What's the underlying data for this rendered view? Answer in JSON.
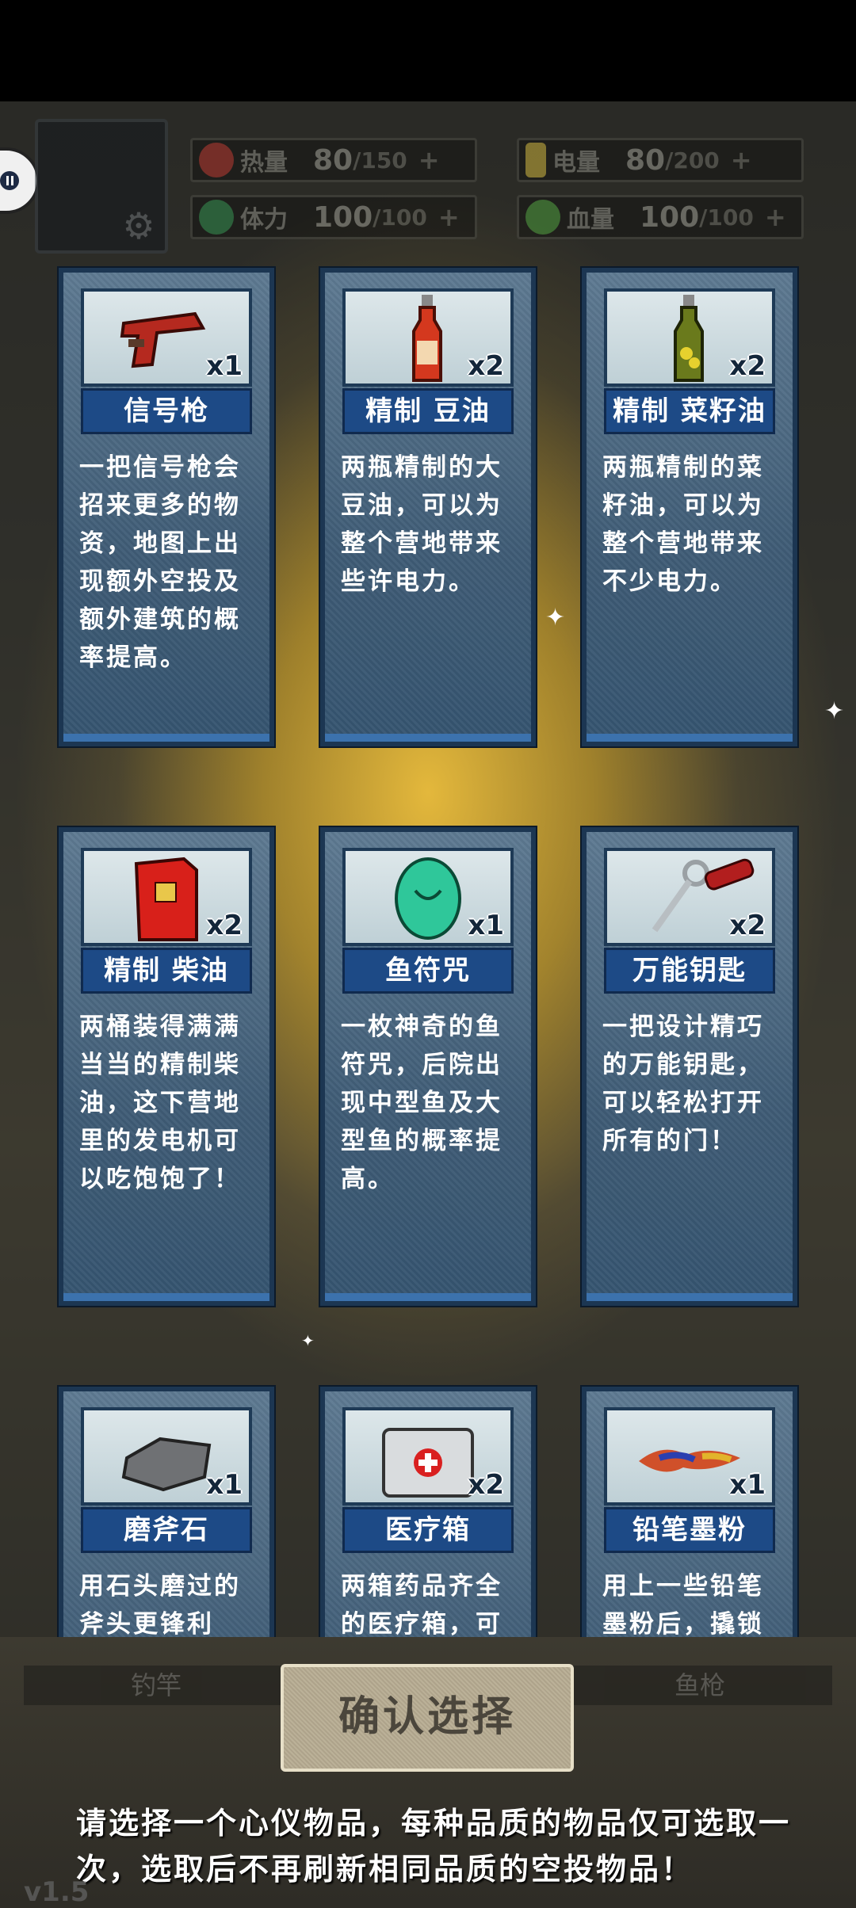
{
  "hud": {
    "stats": [
      {
        "label": "热量",
        "value": "80",
        "max": "/150",
        "plus": "+",
        "color": "#b3322a",
        "icon": "flame-icon"
      },
      {
        "label": "电量",
        "value": "80",
        "max": "/200",
        "plus": "+",
        "color": "#c9b03a",
        "icon": "battery-icon"
      },
      {
        "label": "体力",
        "value": "100",
        "max": "/100",
        "plus": "+",
        "color": "#2e8a4a",
        "icon": "lightning-icon"
      },
      {
        "label": "血量",
        "value": "100",
        "max": "/100",
        "plus": "+",
        "color": "#4a9a3a",
        "icon": "blood-drop-icon"
      }
    ],
    "bg_labels": [
      "钓竿",
      "鱼枪"
    ],
    "version": "v1.5"
  },
  "cards": [
    {
      "name": "信号枪",
      "qty": "x1",
      "icon": "flare-gun-icon",
      "desc": "一把信号枪会招来更多的物资，地图上出现额外空投及额外建筑的概率提高。"
    },
    {
      "name": "精制 豆油",
      "qty": "x2",
      "icon": "soybean-oil-bottle-icon",
      "desc": "两瓶精制的大豆油，可以为整个营地带来些许电力。"
    },
    {
      "name": "精制 菜籽油",
      "qty": "x2",
      "icon": "rapeseed-oil-bottle-icon",
      "desc": "两瓶精制的菜籽油，可以为整个营地带来不少电力。"
    },
    {
      "name": "精制 柴油",
      "qty": "x2",
      "icon": "diesel-can-icon",
      "desc": "两桶装得满满当当的精制柴油，这下营地里的发电机可以吃饱饱了！"
    },
    {
      "name": "鱼符咒",
      "qty": "x1",
      "icon": "fish-amulet-icon",
      "desc": "一枚神奇的鱼符咒，后院出现中型鱼及大型鱼的概率提高。"
    },
    {
      "name": "万能钥匙",
      "qty": "x2",
      "icon": "master-key-icon",
      "desc": "一把设计精巧的万能钥匙，可以轻松打开所有的门！"
    },
    {
      "name": "磨斧石",
      "qty": "x1",
      "icon": "whetstone-icon",
      "desc": "用石头磨过的斧头更锋利"
    },
    {
      "name": "医疗箱",
      "qty": "x2",
      "icon": "medical-kit-icon",
      "desc": "两箱药品齐全的医疗箱，可"
    },
    {
      "name": "铅笔墨粉",
      "qty": "x1",
      "icon": "pencil-toner-icon",
      "desc": "用上一些铅笔墨粉后，撬锁"
    }
  ],
  "confirm_label": "确认选择",
  "hint": "请选择一个心仪物品，每种品质的物品仅可选取一次，选取后不再刷新相同品质的空投物品！"
}
